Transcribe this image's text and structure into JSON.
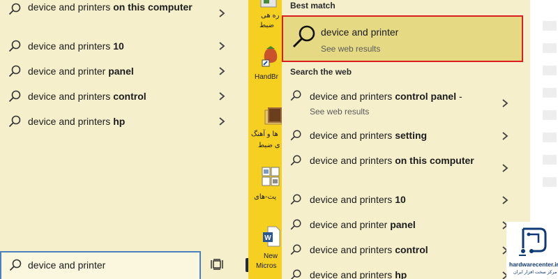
{
  "left": {
    "items": [
      {
        "prefix": "device and printers",
        "bold": "on this computer"
      },
      {
        "prefix": "device and printers",
        "bold": "10"
      },
      {
        "prefix": "device and printer",
        "bold": "panel"
      },
      {
        "prefix": "device and printers",
        "bold": "control"
      },
      {
        "prefix": "device and printers",
        "bold": "hp"
      }
    ],
    "search_value": "device and printer"
  },
  "desktop": {
    "icons": [
      {
        "label1": "ره هی",
        "label2": "ضبط"
      },
      {
        "label1": "HandBr"
      },
      {
        "label1": "ها و آهنگ",
        "label2": "ی ضبط"
      },
      {
        "label1": "یت-های"
      },
      {
        "label1": "New",
        "label2": "Micros"
      }
    ]
  },
  "right": {
    "best_match_heading": "Best match",
    "best_match": {
      "title": "device and printer",
      "subtitle": "See web results"
    },
    "web_heading": "Search the web",
    "items": [
      {
        "prefix": "device and printers",
        "bold": "control panel",
        "suffix": " -",
        "sub": "See web results"
      },
      {
        "prefix": "device and printers",
        "bold": "setting"
      },
      {
        "prefix": "device and printers",
        "bold": "on this computer"
      },
      {
        "prefix": "device and printers",
        "bold": "10"
      },
      {
        "prefix": "device and printer",
        "bold": "panel"
      },
      {
        "prefix": "device and printers",
        "bold": "control"
      },
      {
        "prefix": "device and printers",
        "bold": "hp"
      }
    ]
  },
  "logo": {
    "name": "hardwarecenter.ir",
    "tagline": "مرکز سخت افزار ایران"
  },
  "colors": {
    "accent_border": "#d81e1e",
    "highlight": "#e6d983",
    "panel_bg": "#f5efcc",
    "search_border": "#4a7fc0",
    "logo_blue": "#0f3a75"
  }
}
